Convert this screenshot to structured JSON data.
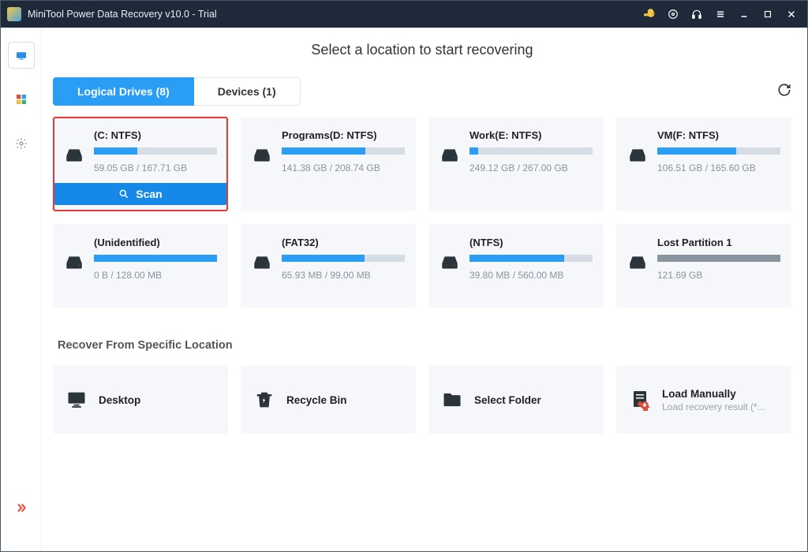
{
  "titlebar": {
    "title": "MiniTool Power Data Recovery v10.0 - Trial"
  },
  "page": {
    "heading": "Select a location to start recovering"
  },
  "tabs": {
    "logical": "Logical Drives (8)",
    "devices": "Devices (1)"
  },
  "scan_label": "Scan",
  "drives": [
    {
      "name": "(C: NTFS)",
      "size": "59.05 GB / 167.71 GB",
      "pct": 35,
      "selected": true
    },
    {
      "name": "Programs(D: NTFS)",
      "size": "141.38 GB / 208.74 GB",
      "pct": 68
    },
    {
      "name": "Work(E: NTFS)",
      "size": "249.12 GB / 267.00 GB",
      "pct": 7
    },
    {
      "name": "VM(F: NTFS)",
      "size": "106.51 GB / 165.60 GB",
      "pct": 64
    },
    {
      "name": "(Unidentified)",
      "size": "0 B / 128.00 MB",
      "pct": 100
    },
    {
      "name": "(FAT32)",
      "size": "65.93 MB / 99.00 MB",
      "pct": 67
    },
    {
      "name": "(NTFS)",
      "size": "39.80 MB / 560.00 MB",
      "pct": 77
    },
    {
      "name": "Lost Partition 1",
      "size": "121.69 GB",
      "pct": 100,
      "lost": true
    }
  ],
  "section": "Recover From Specific Location",
  "locations": {
    "desktop": "Desktop",
    "recycle": "Recycle Bin",
    "folder": "Select Folder",
    "manual_title": "Load Manually",
    "manual_sub": "Load recovery result (*..."
  }
}
